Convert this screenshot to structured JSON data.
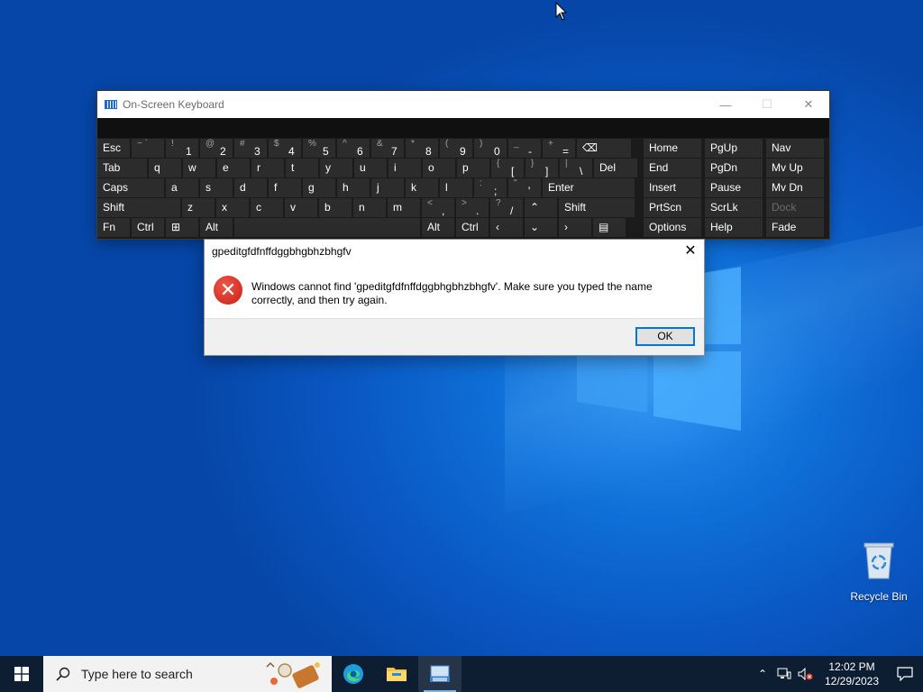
{
  "osk": {
    "title": "On-Screen Keyboard",
    "minimize": "—",
    "maximize": "☐",
    "close": "✕",
    "rows": [
      [
        {
          "name": "key-esc",
          "main": "Esc"
        },
        {
          "name": "key-tilde",
          "sub": "~ `",
          "main": ""
        },
        {
          "name": "key-1",
          "sub": "!",
          "main": "1"
        },
        {
          "name": "key-2",
          "sub": "@",
          "main": "2"
        },
        {
          "name": "key-3",
          "sub": "#",
          "main": "3"
        },
        {
          "name": "key-4",
          "sub": "$",
          "main": "4"
        },
        {
          "name": "key-5",
          "sub": "%",
          "main": "5"
        },
        {
          "name": "key-6",
          "sub": "^",
          "main": "6"
        },
        {
          "name": "key-7",
          "sub": "&",
          "main": "7"
        },
        {
          "name": "key-8",
          "sub": "*",
          "main": "8"
        },
        {
          "name": "key-9",
          "sub": "(",
          "main": "9"
        },
        {
          "name": "key-0",
          "sub": ")",
          "main": "0"
        },
        {
          "name": "key-minus",
          "sub": "_",
          "main": "-"
        },
        {
          "name": "key-equals",
          "sub": "+",
          "main": "="
        },
        {
          "name": "key-backspace",
          "main": "⌫"
        },
        {
          "name": "key-home",
          "main": "Home"
        },
        {
          "name": "key-pgup",
          "main": "PgUp"
        },
        {
          "name": "key-nav",
          "main": "Nav"
        }
      ],
      [
        {
          "name": "key-tab",
          "main": "Tab"
        },
        {
          "name": "key-q",
          "main": "q"
        },
        {
          "name": "key-w",
          "main": "w"
        },
        {
          "name": "key-e",
          "main": "e"
        },
        {
          "name": "key-r",
          "main": "r"
        },
        {
          "name": "key-t",
          "main": "t"
        },
        {
          "name": "key-y",
          "main": "y"
        },
        {
          "name": "key-u",
          "main": "u"
        },
        {
          "name": "key-i",
          "main": "i"
        },
        {
          "name": "key-o",
          "main": "o"
        },
        {
          "name": "key-p",
          "main": "p"
        },
        {
          "name": "key-lbracket",
          "sub": "{",
          "main": "["
        },
        {
          "name": "key-rbracket",
          "sub": "}",
          "main": "]"
        },
        {
          "name": "key-backslash",
          "sub": "|",
          "main": "\\"
        },
        {
          "name": "key-del",
          "main": "Del"
        },
        {
          "name": "key-end",
          "main": "End"
        },
        {
          "name": "key-pgdn",
          "main": "PgDn"
        },
        {
          "name": "key-mvup",
          "main": "Mv Up"
        }
      ],
      [
        {
          "name": "key-caps",
          "main": "Caps"
        },
        {
          "name": "key-a",
          "main": "a"
        },
        {
          "name": "key-s",
          "main": "s"
        },
        {
          "name": "key-d",
          "main": "d"
        },
        {
          "name": "key-f",
          "main": "f"
        },
        {
          "name": "key-g",
          "main": "g"
        },
        {
          "name": "key-h",
          "main": "h"
        },
        {
          "name": "key-j",
          "main": "j"
        },
        {
          "name": "key-k",
          "main": "k"
        },
        {
          "name": "key-l",
          "main": "l"
        },
        {
          "name": "key-semicolon",
          "sub": ":",
          "main": ";"
        },
        {
          "name": "key-quote",
          "sub": "\"",
          "main": "'"
        },
        {
          "name": "key-enter",
          "main": "Enter"
        },
        {
          "name": "key-insert",
          "main": "Insert"
        },
        {
          "name": "key-pause",
          "main": "Pause"
        },
        {
          "name": "key-mvdn",
          "main": "Mv Dn"
        }
      ],
      [
        {
          "name": "key-shift-left",
          "main": "Shift"
        },
        {
          "name": "key-z",
          "main": "z"
        },
        {
          "name": "key-x",
          "main": "x"
        },
        {
          "name": "key-c",
          "main": "c"
        },
        {
          "name": "key-v",
          "main": "v"
        },
        {
          "name": "key-b",
          "main": "b"
        },
        {
          "name": "key-n",
          "main": "n"
        },
        {
          "name": "key-m",
          "main": "m"
        },
        {
          "name": "key-comma",
          "sub": "<",
          "main": ","
        },
        {
          "name": "key-period",
          "sub": ">",
          "main": "."
        },
        {
          "name": "key-slash",
          "sub": "?",
          "main": "/"
        },
        {
          "name": "key-up",
          "main": "⌃"
        },
        {
          "name": "key-shift-right",
          "main": "Shift"
        },
        {
          "name": "key-prtscn",
          "main": "PrtScn"
        },
        {
          "name": "key-scrlk",
          "main": "ScrLk"
        },
        {
          "name": "key-dock",
          "main": "Dock",
          "dim": true
        }
      ],
      [
        {
          "name": "key-fn",
          "main": "Fn"
        },
        {
          "name": "key-ctrl-left",
          "main": "Ctrl"
        },
        {
          "name": "key-windows",
          "main": "⊞"
        },
        {
          "name": "key-alt-left",
          "main": "Alt"
        },
        {
          "name": "key-space",
          "main": ""
        },
        {
          "name": "key-alt-right",
          "main": "Alt"
        },
        {
          "name": "key-ctrl-right",
          "main": "Ctrl"
        },
        {
          "name": "key-left",
          "main": "‹"
        },
        {
          "name": "key-down",
          "main": "⌄"
        },
        {
          "name": "key-right",
          "main": "›"
        },
        {
          "name": "key-menu",
          "main": "▤"
        },
        {
          "name": "key-options",
          "main": "Options"
        },
        {
          "name": "key-help",
          "main": "Help"
        },
        {
          "name": "key-fade",
          "main": "Fade"
        }
      ]
    ]
  },
  "dialog": {
    "title": "gpeditgfdfnffdggbhgbhzbhgfv",
    "close": "✕",
    "icon": "error-icon",
    "message": "Windows cannot find 'gpeditgfdfnffdggbhgbhzbhgfv'. Make sure you typed the name correctly, and then try again.",
    "ok_label": "OK"
  },
  "desktop": {
    "recycle_bin_label": "Recycle Bin"
  },
  "taskbar": {
    "search_placeholder": "Type here to search",
    "apps": [
      "edge-icon",
      "file-explorer-icon",
      "on-screen-keyboard-icon"
    ],
    "clock_time": "12:02 PM",
    "clock_date": "12/29/2023"
  },
  "colors": {
    "accent": "#0078d7",
    "desktop": "#0a58c4",
    "taskbar": "#0d1d32",
    "error": "#d32f24"
  }
}
